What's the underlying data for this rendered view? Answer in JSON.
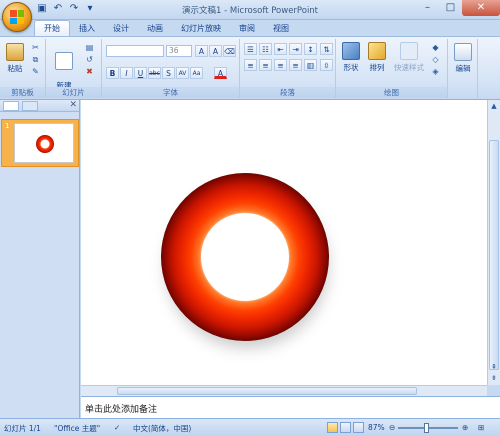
{
  "window": {
    "title": "演示文稿1 - Microsoft PowerPoint"
  },
  "quick_access": [
    "save-icon",
    "undo-icon",
    "redo-icon",
    "customize-icon"
  ],
  "tabs": [
    {
      "label": "开始",
      "active": true
    },
    {
      "label": "插入"
    },
    {
      "label": "设计"
    },
    {
      "label": "动画"
    },
    {
      "label": "幻灯片放映"
    },
    {
      "label": "审阅"
    },
    {
      "label": "视图"
    }
  ],
  "ribbon": {
    "clipboard": {
      "label": "剪贴板",
      "paste": "粘贴"
    },
    "slides": {
      "label": "幻灯片",
      "new_slide": "新建\n幻灯片"
    },
    "font": {
      "label": "字体",
      "font_name": "",
      "font_size": "36",
      "buttons": [
        "B",
        "I",
        "U",
        "abc",
        "S",
        "AV",
        "Aa",
        "A"
      ]
    },
    "paragraph": {
      "label": "段落"
    },
    "drawing": {
      "label": "绘图",
      "shapes": "形状",
      "arrange": "排列",
      "quick_styles": "快速样式"
    },
    "editing": {
      "label": "编辑"
    }
  },
  "slides_panel": {
    "slide_number": "1"
  },
  "notes": {
    "placeholder": "单击此处添加备注"
  },
  "status": {
    "slide": "幻灯片 1/1",
    "theme": "\"Office 主题\"",
    "language": "中文(简体，中国)",
    "zoom": "87%"
  },
  "colors": {
    "ring_outer": "#c81500",
    "ring_mid": "#ff4100",
    "ring_inner": "#ff7a2a",
    "ribbon_bg": "#d6e4f6",
    "tab_text": "#15428b"
  }
}
